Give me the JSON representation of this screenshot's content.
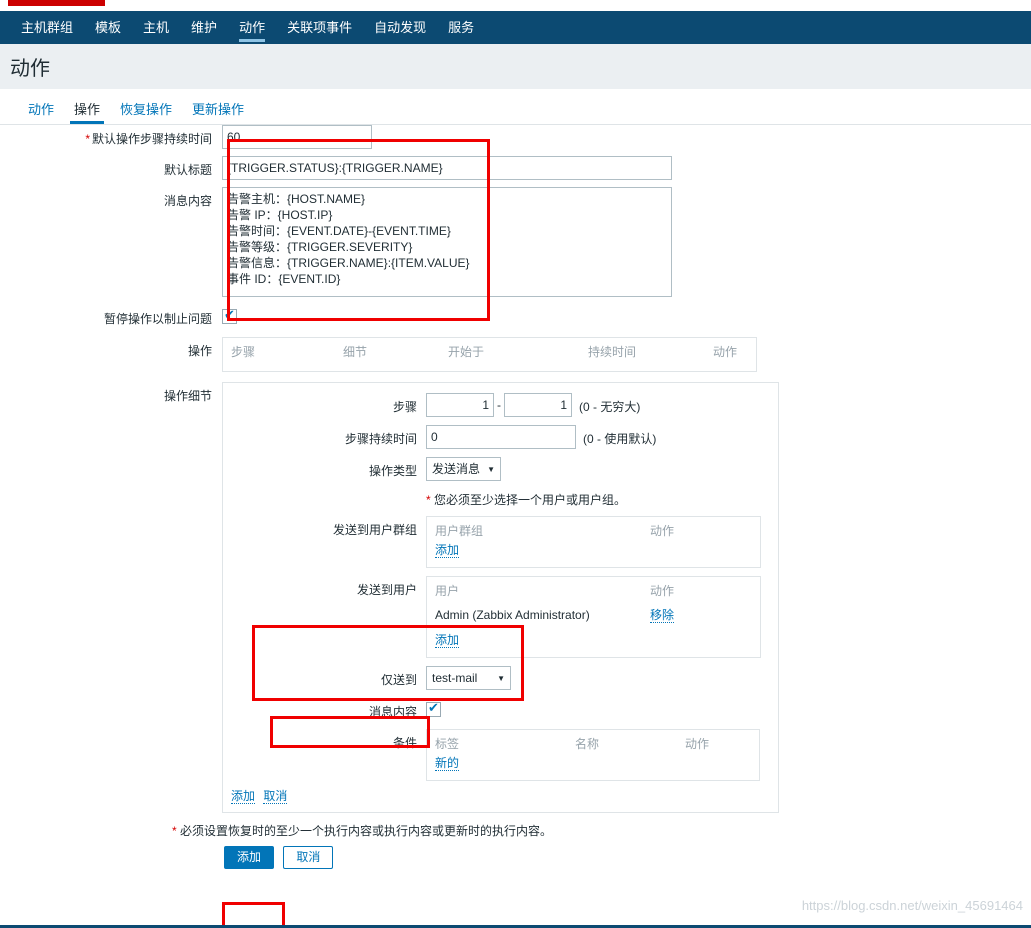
{
  "nav": {
    "items": [
      {
        "label": "主机群组",
        "active": false
      },
      {
        "label": "模板",
        "active": false
      },
      {
        "label": "主机",
        "active": false
      },
      {
        "label": "维护",
        "active": false
      },
      {
        "label": "动作",
        "active": true
      },
      {
        "label": "关联项事件",
        "active": false
      },
      {
        "label": "自动发现",
        "active": false
      },
      {
        "label": "服务",
        "active": false
      }
    ]
  },
  "header": {
    "title": "动作"
  },
  "subtabs": [
    {
      "label": "动作",
      "active": false
    },
    {
      "label": "操作",
      "active": true
    },
    {
      "label": "恢复操作",
      "active": false
    },
    {
      "label": "更新操作",
      "active": false
    }
  ],
  "form": {
    "default_step_duration": {
      "label": "默认操作步骤持续时间",
      "required": true,
      "value": "60"
    },
    "default_subject": {
      "label": "默认标题",
      "value": "{TRIGGER.STATUS}:{TRIGGER.NAME}"
    },
    "message_body": {
      "label": "消息内容",
      "value": "告警主机：{HOST.NAME}\n告警 IP：{HOST.IP}\n告警时间：{EVENT.DATE}-{EVENT.TIME}\n告警等级：{TRIGGER.SEVERITY}\n告警信息：{TRIGGER.NAME}:{ITEM.VALUE}\n事件 ID：{EVENT.ID}"
    },
    "pause_operations": {
      "label": "暂停操作以制止问题",
      "checked": true
    },
    "operations": {
      "label": "操作",
      "columns": [
        "步骤",
        "细节",
        "开始于",
        "持续时间",
        "动作"
      ]
    },
    "operation_details": {
      "label": "操作细节",
      "steps": {
        "label": "步骤",
        "from": "1",
        "to": "1",
        "separator": "-",
        "hint": "(0 - 无穷大)"
      },
      "step_duration": {
        "label": "步骤持续时间",
        "value": "0",
        "hint": "(0 - 使用默认)"
      },
      "operation_type": {
        "label": "操作类型",
        "value": "发送消息"
      },
      "required_note": "您必须至少选择一个用户或用户组。",
      "send_to_user_groups": {
        "label": "发送到用户群组",
        "col_name": "用户群组",
        "col_action": "动作",
        "add_link": "添加",
        "rows": []
      },
      "send_to_users": {
        "label": "发送到用户",
        "col_name": "用户",
        "col_action": "动作",
        "add_link": "添加",
        "rows": [
          {
            "name": "Admin (Zabbix Administrator)",
            "action": "移除"
          }
        ]
      },
      "send_only_to": {
        "label": "仅送到",
        "value": "test-mail"
      },
      "custom_message": {
        "label": "消息内容",
        "checked": true
      },
      "conditions": {
        "label": "条件",
        "col_label": "标签",
        "col_name": "名称",
        "col_action": "动作",
        "new_link": "新的"
      },
      "panel_actions": {
        "add": "添加",
        "cancel": "取消"
      }
    }
  },
  "footer": {
    "note": "必须设置恢复时的至少一个执行内容或执行内容或更新时的执行内容。",
    "submit": "添加",
    "cancel": "取消"
  },
  "watermark": "https://blog.csdn.net/weixin_45691464"
}
